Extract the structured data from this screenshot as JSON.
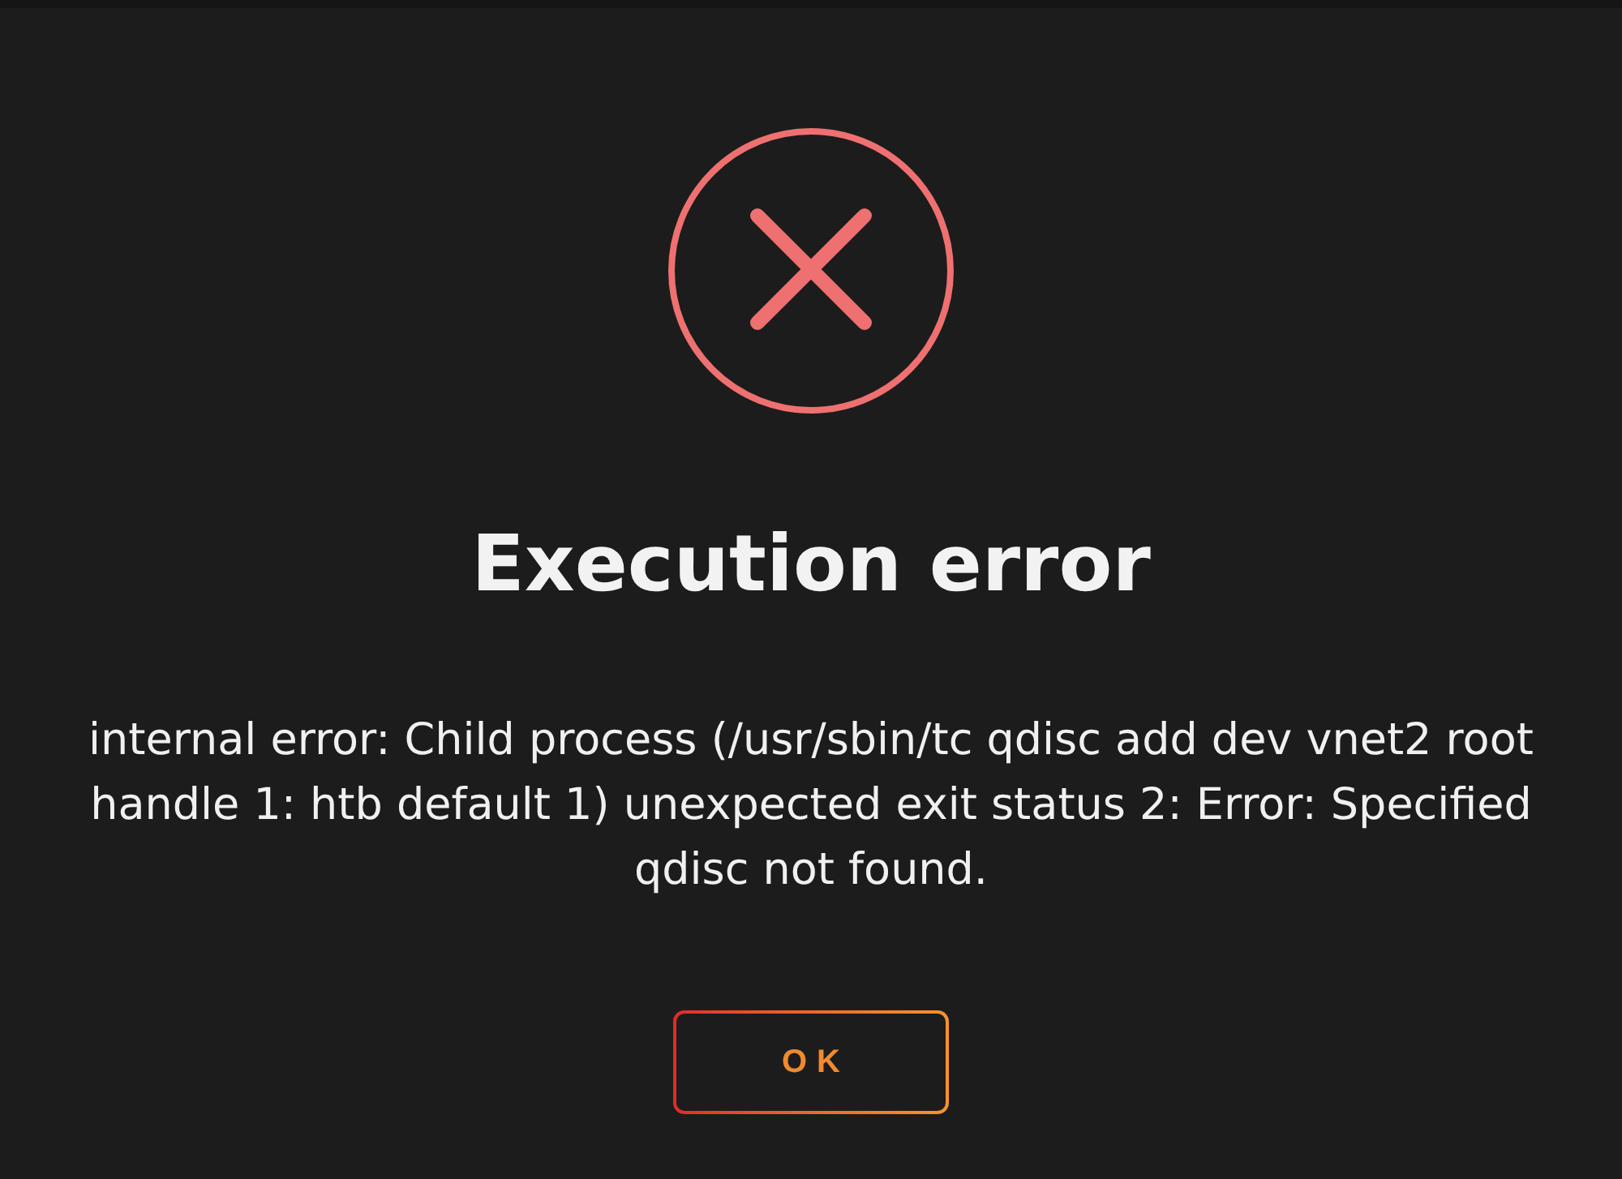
{
  "dialog": {
    "title": "Execution error",
    "message": "internal error: Child process (/usr/sbin/tc qdisc add dev vnet2 root handle 1: htb default 1) unexpected exit status 2: Error: Specified qdisc not found.",
    "buttons": [
      {
        "label": "OK"
      }
    ]
  }
}
